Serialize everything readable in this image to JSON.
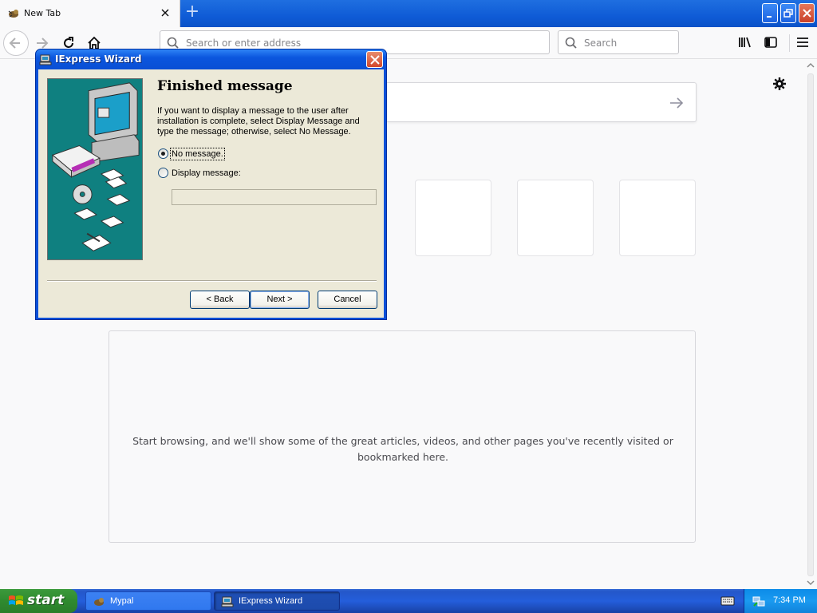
{
  "browser": {
    "tab": {
      "title": "New Tab"
    },
    "new_tab_symbol": "+",
    "urlbar": {
      "placeholder": "Search or enter address"
    },
    "searchbar": {
      "placeholder": "Search"
    }
  },
  "newtab": {
    "highlights_message": "Start browsing, and we'll show some of the great articles, videos, and other pages you've recently visited or bookmarked here."
  },
  "dialog": {
    "title": "IExpress Wizard",
    "heading": "Finished message",
    "description": "If you want to display a message to the user after installation is complete, select Display Message and type the message; otherwise, select No Message.",
    "options": [
      {
        "label": "No message.",
        "checked": true
      },
      {
        "label": "Display message:",
        "checked": false
      }
    ],
    "message_value": "",
    "buttons": {
      "back": "< Back",
      "next": "Next >",
      "cancel": "Cancel"
    }
  },
  "taskbar": {
    "start_label": "start",
    "tasks": [
      {
        "label": "Mypal",
        "active": false
      },
      {
        "label": "IExpress Wizard",
        "active": true
      }
    ],
    "clock": "7:34 PM"
  },
  "colors": {
    "xp_blue": "#0a50d8",
    "start_green": "#3c9a3c",
    "wizard_art_teal": "#0f8080"
  }
}
